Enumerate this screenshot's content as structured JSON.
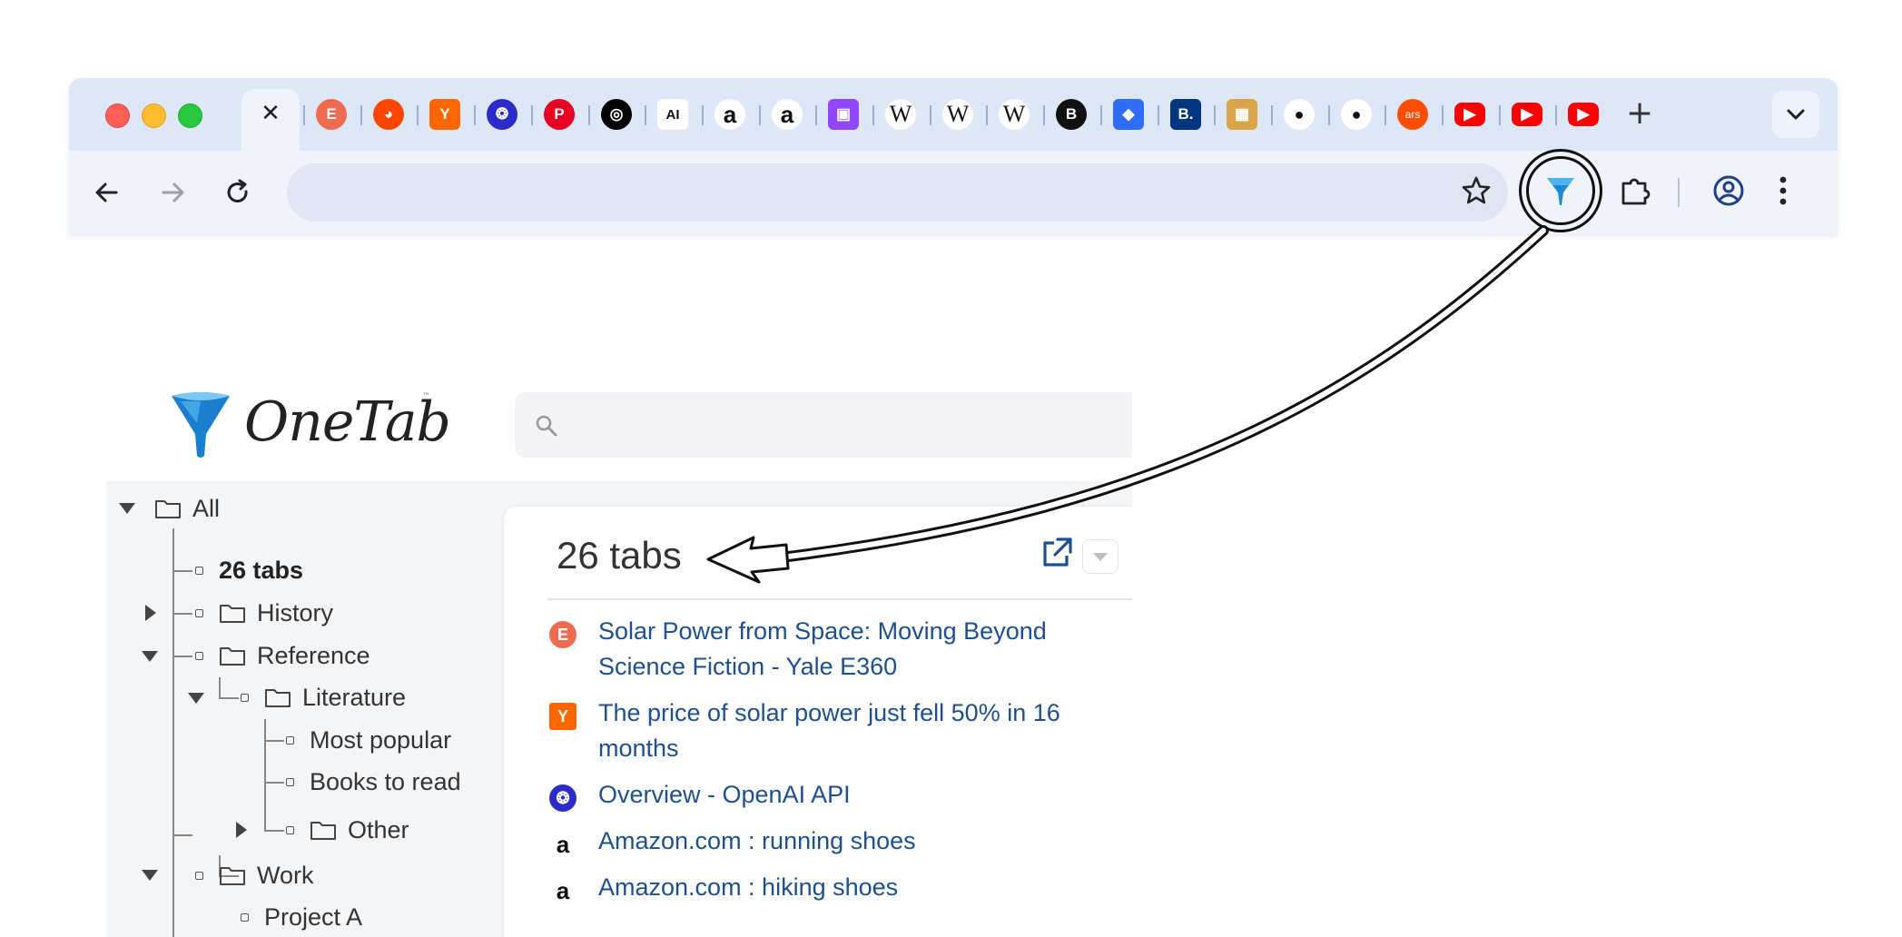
{
  "browser": {
    "window_controls": [
      "close",
      "minimize",
      "zoom"
    ],
    "active_tab_icon": "close-icon",
    "active_tab_glyph": "✕",
    "tabs": [
      {
        "icon": "e360-favicon",
        "glyph": "E",
        "color": "#ee6b52"
      },
      {
        "icon": "reddit-favicon",
        "glyph": "◕",
        "color": "#ff4500"
      },
      {
        "icon": "hackernews-favicon",
        "glyph": "Y",
        "color": "#ff6600"
      },
      {
        "icon": "openai-favicon",
        "glyph": "❂",
        "color": "#2b2bc9"
      },
      {
        "icon": "pinterest-favicon",
        "glyph": "P",
        "color": "#e60023"
      },
      {
        "icon": "threads-favicon",
        "glyph": "◎",
        "color": "#000000"
      },
      {
        "icon": "anthropic-favicon",
        "glyph": "AI",
        "color": "#ffffff"
      },
      {
        "icon": "amazon-favicon",
        "glyph": "a",
        "color": "#ffffff"
      },
      {
        "icon": "amazon-favicon",
        "glyph": "a",
        "color": "#ffffff"
      },
      {
        "icon": "twitch-favicon",
        "glyph": "▣",
        "color": "#9146ff"
      },
      {
        "icon": "wikipedia-favicon",
        "glyph": "W",
        "color": "#ffffff"
      },
      {
        "icon": "wikipedia-favicon",
        "glyph": "W",
        "color": "#ffffff"
      },
      {
        "icon": "wikipedia-favicon",
        "glyph": "W",
        "color": "#ffffff"
      },
      {
        "icon": "bold-b-favicon",
        "glyph": "B",
        "color": "#111111"
      },
      {
        "icon": "roblox-favicon",
        "glyph": "◆",
        "color": "#2f6df6"
      },
      {
        "icon": "booking-favicon",
        "glyph": "B.",
        "color": "#003580"
      },
      {
        "icon": "package-favicon",
        "glyph": "▦",
        "color": "#d9a44a"
      },
      {
        "icon": "apple-favicon",
        "glyph": "●",
        "color": "#ffffff"
      },
      {
        "icon": "apple-favicon",
        "glyph": "●",
        "color": "#ffffff"
      },
      {
        "icon": "ars-favicon",
        "glyph": "ars",
        "color": "#ff4e00"
      },
      {
        "icon": "youtube-favicon",
        "glyph": "▶",
        "color": "#ff0000"
      },
      {
        "icon": "youtube-favicon",
        "glyph": "▶",
        "color": "#ff0000"
      },
      {
        "icon": "youtube-favicon",
        "glyph": "▶",
        "color": "#ff0000"
      }
    ],
    "new_tab_glyph": "+",
    "address_bar_value": ""
  },
  "onetab": {
    "logo_text": "OneTab",
    "logo_tm": "™",
    "search_placeholder": "",
    "tree": [
      {
        "label": "All",
        "kind": "folder"
      },
      {
        "label": "26 tabs",
        "kind": "group"
      },
      {
        "label": "History",
        "kind": "folder"
      },
      {
        "label": "Reference",
        "kind": "folder"
      },
      {
        "label": "Literature",
        "kind": "folder"
      },
      {
        "label": "Most popular",
        "kind": "group"
      },
      {
        "label": "Books to read",
        "kind": "group"
      },
      {
        "label": "Other",
        "kind": "folder"
      },
      {
        "label": "Work",
        "kind": "folder"
      },
      {
        "label": "Project A",
        "kind": "group"
      }
    ],
    "group_title": "26 tabs",
    "links": [
      {
        "title": "Solar Power from Space: Moving Beyond Science Fiction - Yale E360",
        "icon": "e360-favicon",
        "glyph": "E",
        "color": "#ee6b52"
      },
      {
        "title": "The price of solar power just fell 50% in 16 months",
        "icon": "hackernews-favicon",
        "glyph": "Y",
        "color": "#ff6600"
      },
      {
        "title": "Overview - OpenAI API",
        "icon": "openai-favicon",
        "glyph": "❂",
        "color": "#2b2bc9"
      },
      {
        "title": "Amazon.com : running shoes",
        "icon": "amazon-favicon",
        "glyph": "a",
        "color": "#ffffff"
      },
      {
        "title": "Amazon.com : hiking shoes",
        "icon": "amazon-favicon",
        "glyph": "a",
        "color": "#ffffff"
      }
    ]
  },
  "colors": {
    "tabstrip_bg": "#dee7f7",
    "toolbar_bg": "#f0f4fa",
    "link": "#1d4f91",
    "onetab_blue": "#1a8ad8"
  }
}
